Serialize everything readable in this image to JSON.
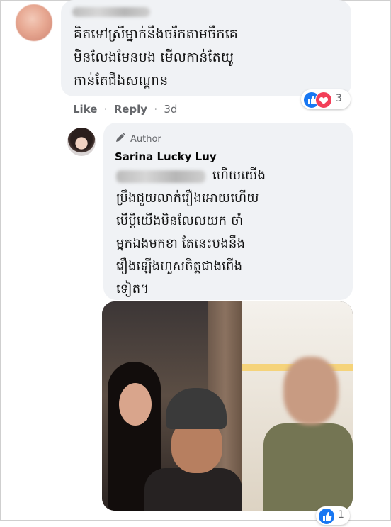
{
  "comment_1": {
    "text": "គិតទៅស្រីម្នាក់នឹងចរឹកតាមចឹកគេ\nមិនលែងមែនបង មើលកាន់តែយូ\nកាន់តែជឺងសណ្ដាន",
    "reaction_count": "3",
    "actions": {
      "like": "Like",
      "reply": "Reply",
      "separator": "·",
      "time": "3d"
    }
  },
  "reply": {
    "badge": "Author",
    "author_name": "Sarina Lucky Luy",
    "text_line1_visible": "ហើយយើង",
    "text_rest": "ប្រឹងជួយលាក់រឿងអោយហើយ\nបើប្ដីយើងមិនលែលយក ចាំ\nម្នកឯងមកខា តែនេះបងនឹង\nរឿងឡើងហួសចិត្តជាងពើង\nទៀត។",
    "reaction_count": "1"
  },
  "colors": {
    "bubble": "#f0f2f5",
    "meta": "#65676b",
    "like": "#1877f2",
    "love": "#f33e58"
  }
}
